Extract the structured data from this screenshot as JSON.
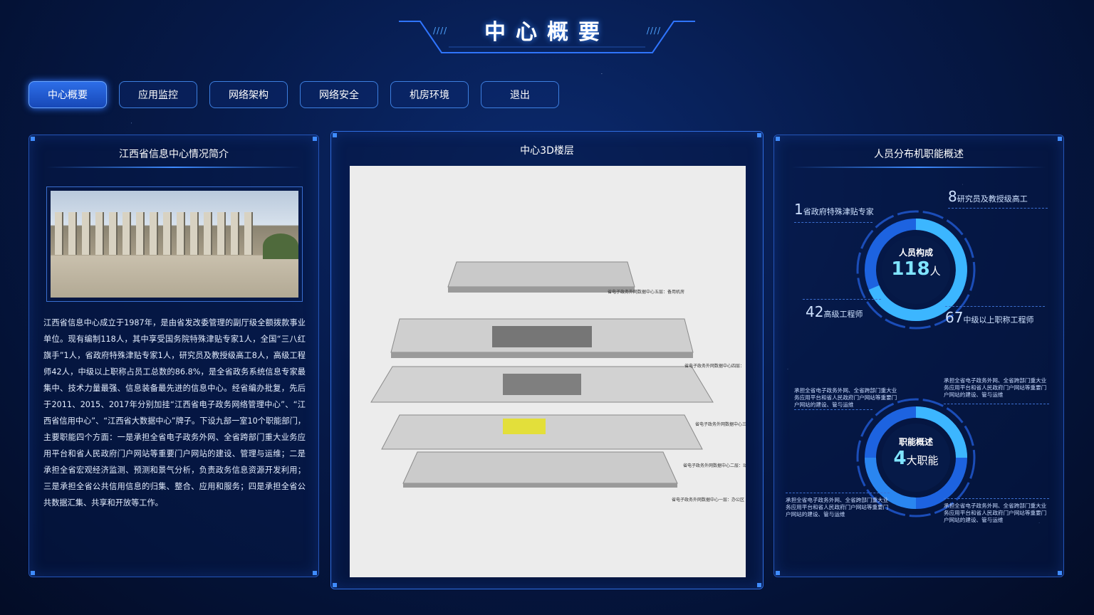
{
  "header": {
    "title": "中心概要",
    "deco_left": "////",
    "deco_right": "////"
  },
  "nav": [
    {
      "label": "中心概要",
      "active": true
    },
    {
      "label": "应用监控"
    },
    {
      "label": "网络架构"
    },
    {
      "label": "网络安全"
    },
    {
      "label": "机房环境"
    },
    {
      "label": "退出"
    }
  ],
  "left_panel": {
    "title": "江西省信息中心情况简介",
    "intro": "江西省信息中心成立于1987年，是由省发改委管理的副厅级全额拨款事业单位。现有编制118人，其中享受国务院特殊津贴专家1人，全国“三八红旗手”1人，省政府特殊津贴专家1人，研究员及教授级高工8人，高级工程师42人，中级以上职称占员工总数的86.8%，是全省政务系统信息专家最集中、技术力量最强、信息装备最先进的信息中心。经省编办批复，先后于2011、2015、2017年分别加挂“江西省电子政务网络管理中心”、“江西省信用中心”、“江西省大数据中心”牌子。下设九部一室10个职能部门，主要职能四个方面：一是承担全省电子政务外网、全省跨部门重大业务应用平台和省人民政府门户网站等重要门户网站的建设、管理与运维；二是承担全省宏观经济监测、预测和景气分析，负责政务信息资源开发利用；三是承担全省公共信用信息的归集、整合、应用和服务；四是承担全省公共数据汇集、共享和开放等工作。"
  },
  "center_panel": {
    "title": "中心3D楼层",
    "floors": [
      "省电子政务外网数据中心五层：备用机房",
      "省电子政务外网数据中心四层：",
      "省电子政务外网数据中心三层",
      "省电子政务外网数据中心二层：动力机房",
      "省电子政务外网数据中心一层：办公区"
    ]
  },
  "right_panel": {
    "title": "人员分布机职能概述",
    "staff": {
      "caption": "人员构成",
      "total": "118",
      "unit": "人",
      "items": [
        {
          "num": "1",
          "label": "省政府特殊津贴专家"
        },
        {
          "num": "8",
          "label": "研究员及教授级高工"
        },
        {
          "num": "42",
          "label": "高级工程师"
        },
        {
          "num": "67",
          "label": "中级以上职称工程师"
        }
      ]
    },
    "duties": {
      "caption": "职能概述",
      "total": "4",
      "unit": "大职能",
      "items": [
        "承担全省电子政务外网、全省跨部门重大业务应用平台和省人民政府门户网站等重要门户网站的建设、管与运维",
        "承担全省电子政务外网、全省跨部门重大业务应用平台和省人民政府门户网站等重要门户网站的建设、管与运维",
        "承担全省电子政务外网、全省跨部门重大业务应用平台和省人民政府门户网站等重要门户网站的建设、管与运维",
        "承担全省电子政务外网、全省跨部门重大业务应用平台和省人民政府门户网站等重要门户网站的建设、管与运维"
      ]
    }
  },
  "colors": {
    "accent": "#3f8cff",
    "ring_light": "#3cb6ff",
    "ring_dark": "#1d63e0"
  }
}
